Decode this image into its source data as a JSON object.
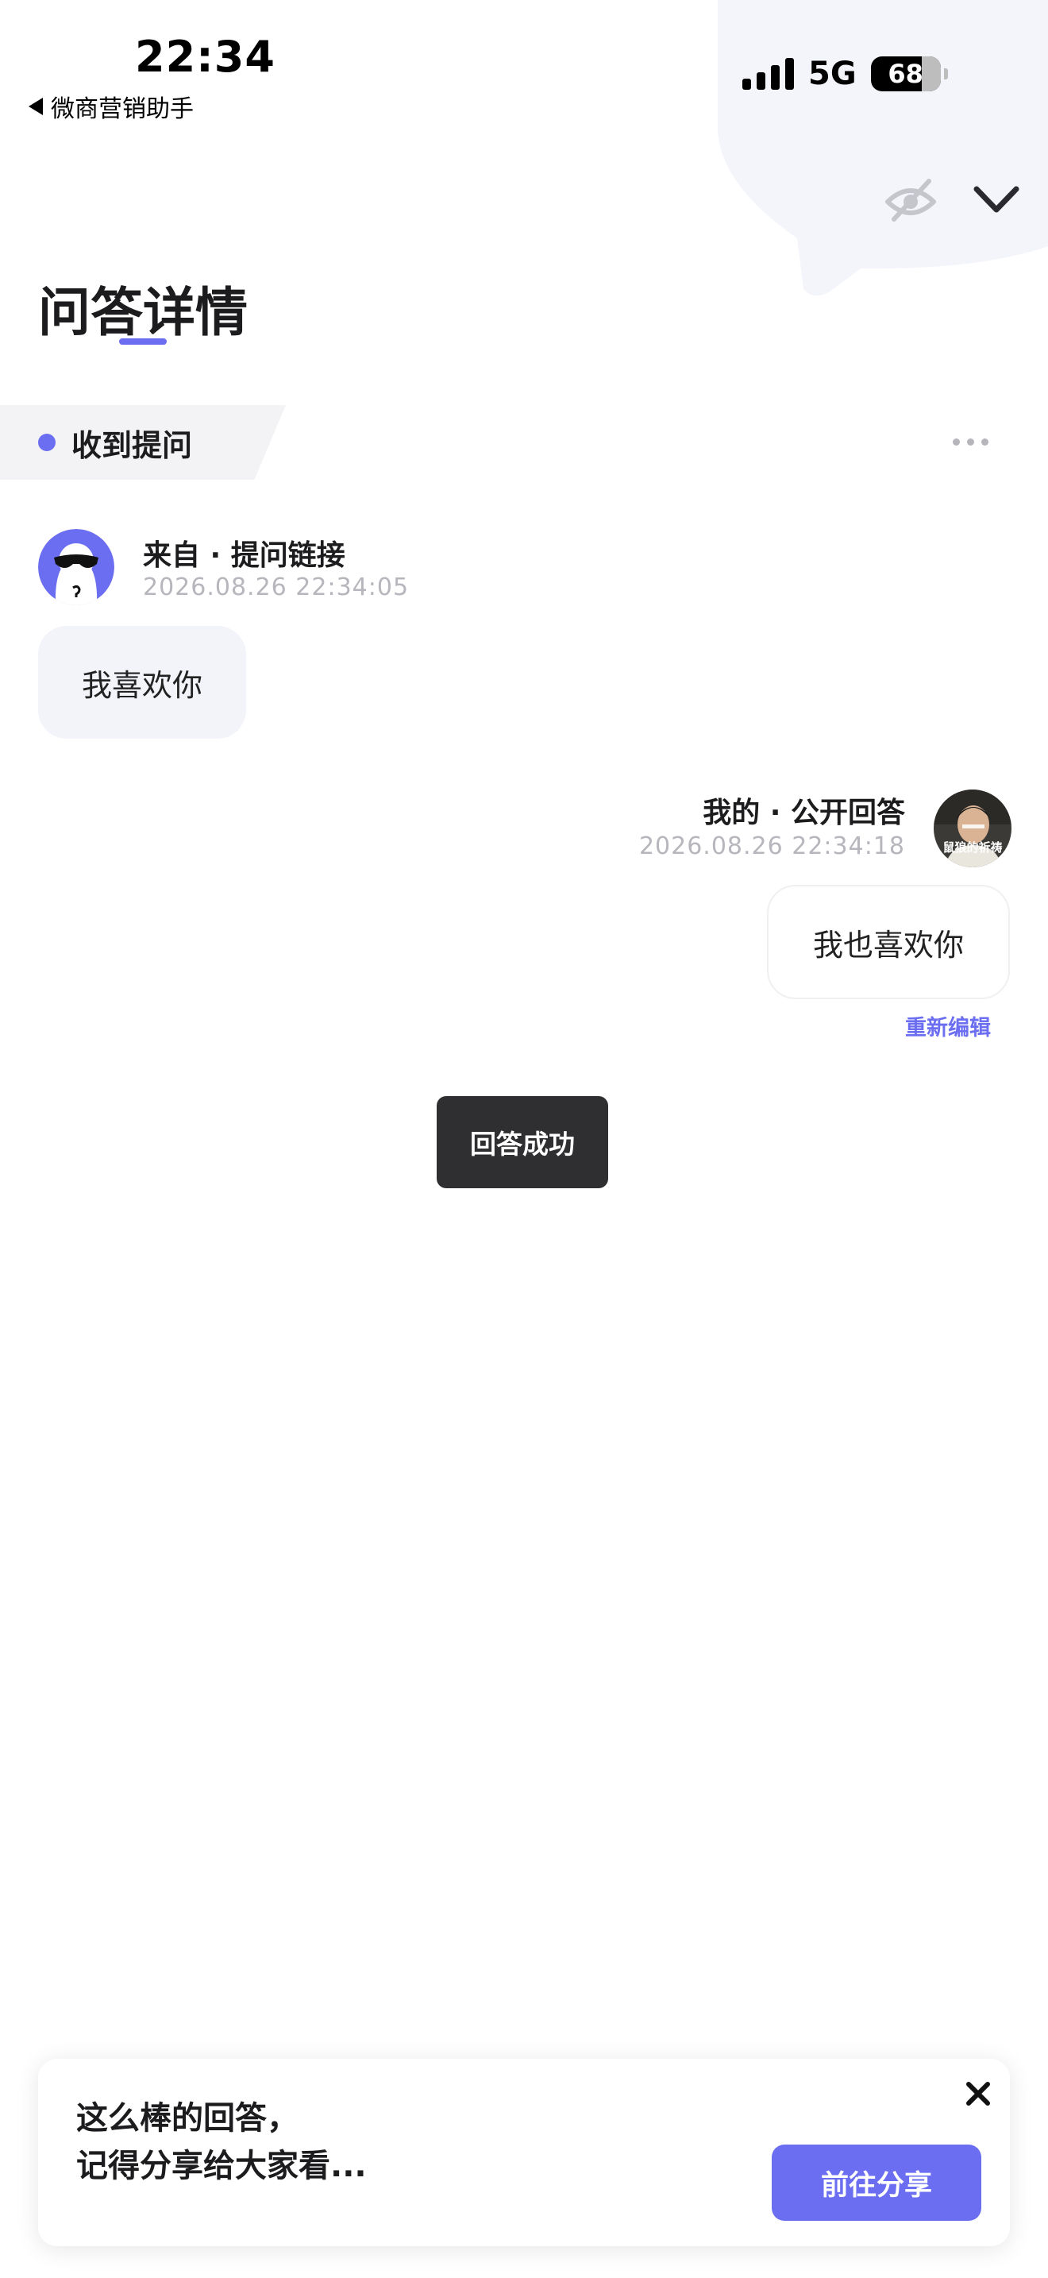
{
  "status_bar": {
    "time": "22:34",
    "back_app": "微商营销助手",
    "network": "5G",
    "battery": "68"
  },
  "header": {
    "title": "问答详情"
  },
  "section": {
    "label": "收到提问"
  },
  "question": {
    "source": "来自 · 提问链接",
    "time": "2026.08.26 22:34:05",
    "text": "我喜欢你"
  },
  "answer": {
    "label": "我的 · 公开回答",
    "time": "2026.08.26 22:34:18",
    "text": "我也喜欢你",
    "reedit": "重新编辑",
    "avatar_caption": "鼠狼的祈祷"
  },
  "toast": {
    "text": "回答成功"
  },
  "share": {
    "line1": "这么棒的回答，",
    "line2": "记得分享给大家看...",
    "button": "前往分享"
  },
  "colors": {
    "accent": "#6b6ef0",
    "bubble_bg": "#f2f4fa",
    "toast_bg": "#2f2f31",
    "muted": "#b6b6bd"
  },
  "icons": {
    "back": "back-triangle-icon",
    "signal": "signal-icon",
    "battery": "battery-icon",
    "hide": "eye-off-icon",
    "collapse": "chevron-down-icon",
    "more": "more-dots-icon",
    "close": "close-icon"
  }
}
